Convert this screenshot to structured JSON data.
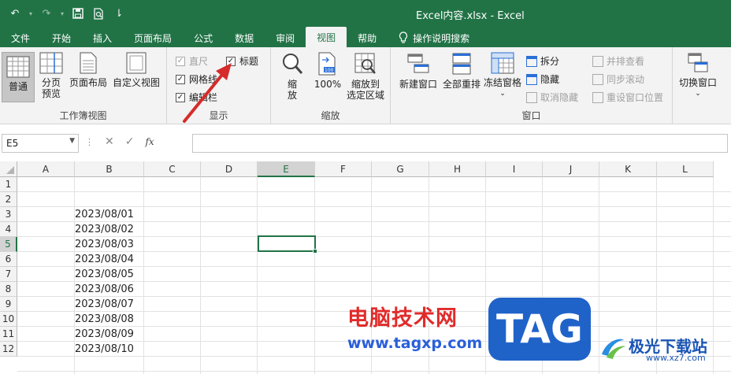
{
  "titlebar": {
    "title": "Excel内容.xlsx  -  Excel",
    "qat_more": "⇂"
  },
  "tabs": [
    {
      "label": "文件"
    },
    {
      "label": "开始"
    },
    {
      "label": "插入"
    },
    {
      "label": "页面布局"
    },
    {
      "label": "公式"
    },
    {
      "label": "数据"
    },
    {
      "label": "审阅"
    },
    {
      "label": "视图"
    },
    {
      "label": "帮助"
    },
    {
      "label": "操作说明搜索"
    }
  ],
  "ribbon": {
    "workbook_views": {
      "label": "工作簿视图",
      "normal": "普通",
      "page_break_1": "分页",
      "page_break_2": "预览",
      "page_layout": "页面布局",
      "custom": "自定义视图"
    },
    "show": {
      "label": "显示",
      "ruler": "直尺",
      "headings": "标题",
      "gridlines": "网格线",
      "formula_bar": "编辑栏"
    },
    "zoom": {
      "label": "缩放",
      "zoom_1": "缩",
      "zoom_2": "放",
      "hundred": "100%",
      "zoom_sel_1": "缩放到",
      "zoom_sel_2": "选定区域"
    },
    "window": {
      "label": "窗口",
      "new_window": "新建窗口",
      "arrange_all": "全部重排",
      "freeze": "冻结窗格",
      "split": "拆分",
      "hide": "隐藏",
      "unhide": "取消隐藏",
      "side_by_side": "并排查看",
      "sync_scroll": "同步滚动",
      "reset_pos": "重设窗口位置",
      "switch": "切换窗口"
    }
  },
  "formula": {
    "name_box": "E5",
    "fx": "fx",
    "value": ""
  },
  "grid": {
    "columns": [
      "A",
      "B",
      "C",
      "D",
      "E",
      "F",
      "G",
      "H",
      "I",
      "J",
      "K",
      "L"
    ],
    "rows": [
      "1",
      "2",
      "3",
      "4",
      "5",
      "6",
      "7",
      "8",
      "9",
      "10",
      "11",
      "12"
    ],
    "selected_cell": "E5",
    "column_b_values": [
      "",
      "",
      "2023/08/01",
      "2023/08/02",
      "2023/08/03",
      "2023/08/04",
      "2023/08/05",
      "2023/08/06",
      "2023/08/07",
      "2023/08/08",
      "2023/08/09",
      "2023/08/10"
    ]
  },
  "watermark": {
    "cn": "电脑技术网",
    "url": "www.tagxp.com",
    "tag": "TAG",
    "site": "极光下载站",
    "site_url": "www.xz7.com"
  },
  "colors": {
    "accent": "#217346",
    "arrow": "#d62b2b"
  }
}
